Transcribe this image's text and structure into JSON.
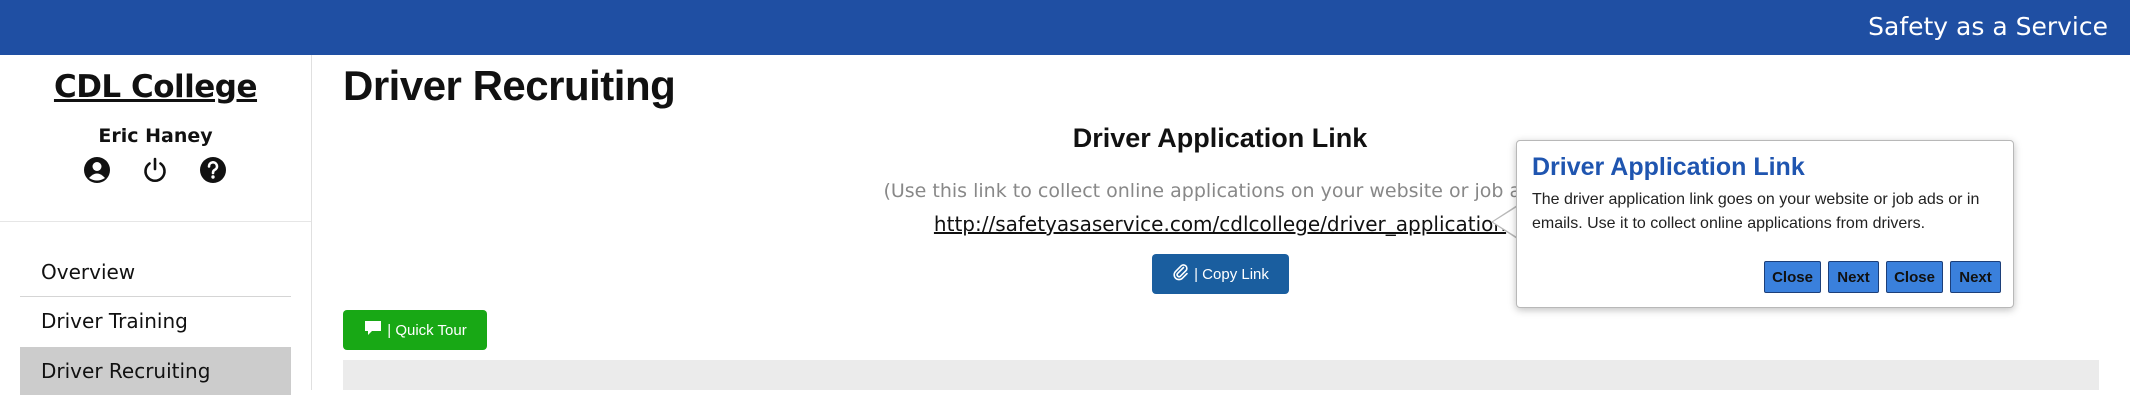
{
  "header": {
    "brand": "Safety as a Service",
    "bar_color": "#1f4fa3"
  },
  "sidebar": {
    "college_name": "CDL College",
    "user_name": "Eric Haney",
    "user_icons": [
      "user-circle-icon",
      "power-icon",
      "help-icon"
    ],
    "items": [
      {
        "label": "Overview",
        "active": false
      },
      {
        "label": "Driver Training",
        "active": false
      },
      {
        "label": "Driver Recruiting",
        "active": true
      }
    ]
  },
  "main": {
    "title": "Driver Recruiting",
    "section_title": "Driver Application Link",
    "hint": "(Use this link to collect online applications on your website or job ads.)",
    "application_link": "http://safetyasaservice.com/cdlcollege/driver_application",
    "copy_button": {
      "icon": "paperclip-icon",
      "label": "| Copy Link",
      "color": "#1a5e9f"
    },
    "quick_tour_button": {
      "icon": "speech-bubble-icon",
      "label": "| Quick Tour",
      "color": "#18a815"
    }
  },
  "popover": {
    "title": "Driver Application Link",
    "text": "The driver application link goes on your website or job ads or in emails. Use it to collect online applications from drivers.",
    "buttons": [
      "Close",
      "Next",
      "Close",
      "Next"
    ],
    "title_color": "#1f55b0",
    "button_color": "#3a80dc"
  }
}
